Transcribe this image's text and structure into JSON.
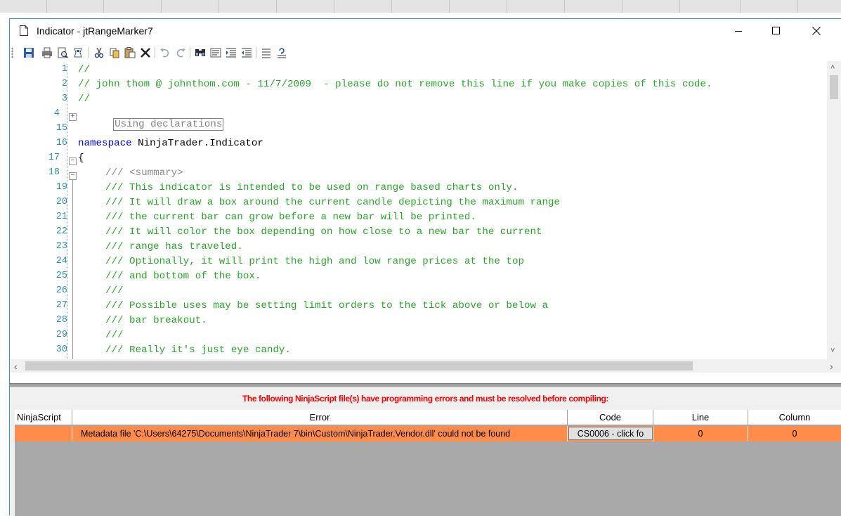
{
  "window": {
    "title": "Indicator - jtRangeMarker7"
  },
  "toolbar": {
    "buttons": [
      "save-icon",
      "print-icon",
      "print-preview-icon",
      "compile-icon",
      "cut-icon",
      "copy-icon",
      "paste-icon",
      "delete-icon",
      "undo-icon",
      "redo-icon",
      "find-icon",
      "find-replace-icon",
      "indent-icon",
      "outdent-icon",
      "comment-icon",
      "uncomment-icon"
    ]
  },
  "editor": {
    "line_numbers": [
      "1",
      "2",
      "3",
      "4",
      "15",
      "16",
      "17",
      "18",
      "19",
      "20",
      "21",
      "22",
      "23",
      "24",
      "25",
      "26",
      "27",
      "28",
      "29",
      "30"
    ],
    "lines": {
      "l1": "//",
      "l2": "// john thom @ johnthom.com - 11/7/2009  - please do not remove this line if you make copies of this code.",
      "l3": "//",
      "l4": "Using declarations",
      "l16_kw": "namespace",
      "l16_rest": " NinjaTrader.Indicator",
      "l17": "{",
      "l18_prefix": "/// ",
      "l18_tag": "<summary>",
      "l19": "/// This indicator is intended to be used on range based charts only.",
      "l20": "/// It will draw a box around the current candle depicting the maximum range",
      "l21": "/// the current bar can grow before a new bar will be printed.",
      "l22": "/// It will color the box depending on how close to a new bar the current",
      "l23": "/// range has traveled.",
      "l24": "/// Optionally, it will print the high and low range prices at the top",
      "l25": "/// and bottom of the box.",
      "l26": "///",
      "l27": "/// Possible uses may be setting limit orders to the tick above or below a",
      "l28": "/// bar breakout.",
      "l29": "///",
      "l30": "/// Really it's just eye candy."
    }
  },
  "errors": {
    "message": "The following NinjaScript file(s) have programming errors and must be resolved before compiling:",
    "columns": {
      "ninjascript": "NinjaScript",
      "error": "Error",
      "code": "Code",
      "line": "Line",
      "column": "Column"
    },
    "rows": [
      {
        "ninjascript": "",
        "error": "Metadata file 'C:\\Users\\64275\\Documents\\NinjaTrader 7\\bin\\Custom\\NinjaTrader.Vendor.dll' could not be found",
        "code": "CS0006 - click fo",
        "line": "0",
        "column": "0"
      }
    ],
    "row_color": "#ff8c4a",
    "message_color": "#ff0000"
  }
}
